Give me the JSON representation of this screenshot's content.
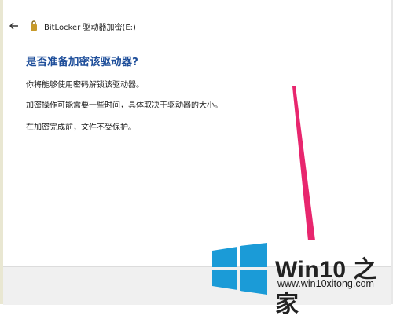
{
  "window": {
    "title": "BitLocker 驱动器加密(E:)",
    "back_icon": "back-arrow-icon",
    "app_icon": "bitlocker-key-icon"
  },
  "main": {
    "heading": "是否准备加密该驱动器?",
    "paragraphs": [
      "你将能够使用密码解锁该驱动器。",
      "加密操作可能需要一些时间，具体取决于驱动器的大小。",
      "在加密完成前，文件不受保护。"
    ]
  },
  "annotation": {
    "color": "#e8266e"
  },
  "watermark": {
    "brand": "Win10 之家",
    "site": "www.win10xitong.com",
    "logo_color": "#1b9bd7"
  }
}
